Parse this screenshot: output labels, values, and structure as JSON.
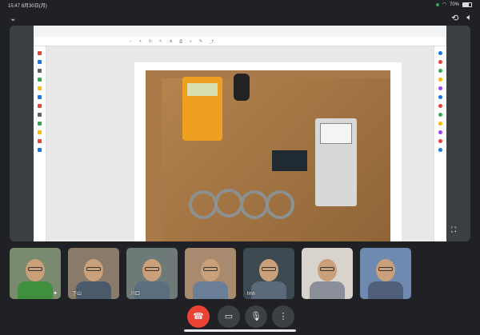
{
  "status_bar": {
    "time": "15:47",
    "date": "8月30日(月)",
    "battery": "70%",
    "battery_level": 0.7
  },
  "meet": {
    "top_icons": [
      "camera-flip-icon",
      "speaker-icon"
    ]
  },
  "presentation": {
    "viewer_notice": "",
    "viewer_button": "",
    "photo_description_icon": "equipment-photo"
  },
  "participants": [
    {
      "name": "",
      "shirt": "#3f8f3f",
      "bg": "#7a8a6e"
    },
    {
      "name": "下山",
      "shirt": "#4a5a6a",
      "bg": "#8a7a6a"
    },
    {
      "name": "川口",
      "shirt": "#5a6e80",
      "bg": "#6e7a78"
    },
    {
      "name": "",
      "shirt": "#6b7f99",
      "bg": "#a88a6e"
    },
    {
      "name": "hhh",
      "shirt": "#5b6a7a",
      "bg": "#3e4a52"
    },
    {
      "name": "",
      "shirt": "#8a8f9a",
      "bg": "#d8d4cc"
    },
    {
      "name": "",
      "shirt": "#4f5f7a",
      "bg": "#6e8ab0"
    }
  ],
  "controls": {
    "end_call": "end-call-icon",
    "camera": "camera-icon",
    "mic": "mic-icon",
    "more": "more-icon"
  },
  "colors": {
    "end_call": "#ea4335",
    "accent": "#1a73e8"
  }
}
